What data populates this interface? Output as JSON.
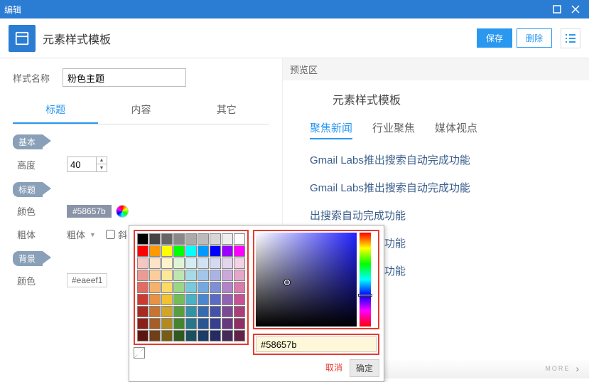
{
  "window": {
    "title": "编辑"
  },
  "header": {
    "title": "元素样式模板",
    "save": "保存",
    "delete": "删除"
  },
  "form": {
    "name_label": "样式名称",
    "name_value": "粉色主题",
    "tabs": {
      "title": "标题",
      "content": "内容",
      "other": "其它"
    },
    "section_basic": "基本",
    "height_label": "高度",
    "height_value": "40",
    "section_title": "标题",
    "color_label": "颜色",
    "color_value": "#58657b",
    "bold_label": "粗体",
    "bold_option": "粗体",
    "italic_partial": "斜",
    "section_bg": "背景",
    "bg_color_label": "颜色",
    "bg_color_value": "#eaeef1"
  },
  "colorpicker": {
    "hex_value": "#58657b",
    "cancel": "取消",
    "ok": "确定",
    "swatches": [
      "#000000",
      "#444444",
      "#666666",
      "#888888",
      "#aaaaaa",
      "#bbbbbb",
      "#d6d6d6",
      "#eeeeee",
      "#ffffff",
      "#ff0000",
      "#ff9900",
      "#ffff00",
      "#00ff00",
      "#00ffff",
      "#0099ff",
      "#0000ff",
      "#9900ff",
      "#ff00ff",
      "#f7c6c3",
      "#fde3c8",
      "#fff4c9",
      "#def5d5",
      "#d3edf3",
      "#d1e2f4",
      "#d4daf1",
      "#e4d4ec",
      "#f2d2e4",
      "#ec9a94",
      "#f9cd9c",
      "#ffe79a",
      "#bde5ad",
      "#a6dbe6",
      "#a3c6ea",
      "#aab4e3",
      "#caa9da",
      "#e6a6c9",
      "#e26b63",
      "#f5b26b",
      "#ffd966",
      "#9ad684",
      "#78c9d9",
      "#74a9de",
      "#7f8fd6",
      "#b084c7",
      "#d97baf",
      "#cc3a30",
      "#e89243",
      "#f1c232",
      "#73bd57",
      "#4ab0c4",
      "#4a87cf",
      "#5a6bc4",
      "#9462b2",
      "#c65295",
      "#a82a21",
      "#c77430",
      "#d1a529",
      "#579e3e",
      "#3592a6",
      "#366bb0",
      "#4651a8",
      "#7a4a95",
      "#a93e7b",
      "#8a2119",
      "#a55e25",
      "#b18b20",
      "#45842f",
      "#287689",
      "#2a5693",
      "#36408e",
      "#643b7e",
      "#8e3066",
      "#5e1510",
      "#6f3f18",
      "#765c15",
      "#2f5a1f",
      "#1b5060",
      "#1d3c68",
      "#252c64",
      "#452958",
      "#622148"
    ]
  },
  "preview": {
    "section_label": "预览区",
    "heading": "元素样式模板",
    "tabs": {
      "a": "聚焦新闻",
      "b": "行业聚焦",
      "c": "媒体视点"
    },
    "items": [
      "Gmail Labs推出搜索自动完成功能",
      "Gmail Labs推出搜索自动完成功能",
      "出搜索自动完成功能",
      "出搜索自动完成功能",
      "出搜索自动完成功能"
    ],
    "more": "MORE"
  }
}
